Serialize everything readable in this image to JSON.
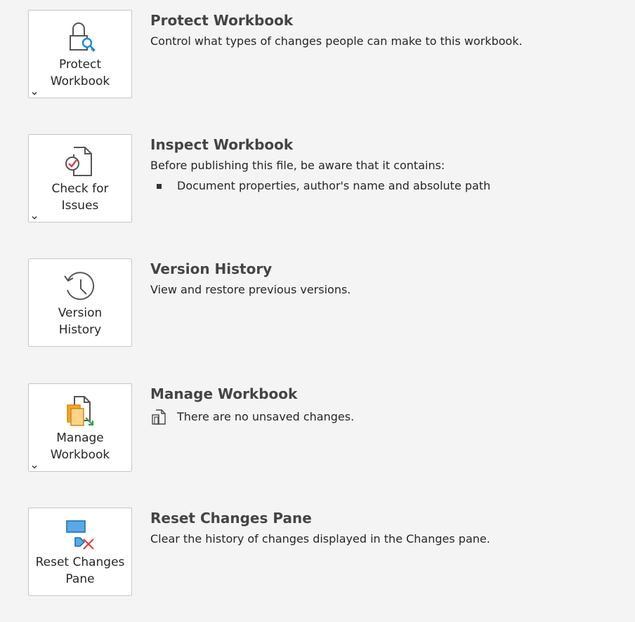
{
  "sections": [
    {
      "tile_label_1": "Protect",
      "tile_label_2": "Workbook",
      "title": "Protect Workbook",
      "description": "Control what types of changes people can make to this workbook.",
      "icon": "lock-key-icon",
      "has_dropdown": true
    },
    {
      "tile_label_1": "Check for",
      "tile_label_2": "Issues",
      "title": "Inspect Workbook",
      "description": "Before publishing this file, be aware that it contains:",
      "bullet": "Document properties, author's name and absolute path",
      "icon": "document-check-icon",
      "has_dropdown": true
    },
    {
      "tile_label_1": "Version",
      "tile_label_2": "History",
      "title": "Version History",
      "description": "View and restore previous versions.",
      "icon": "history-clock-icon",
      "has_dropdown": false
    },
    {
      "tile_label_1": "Manage",
      "tile_label_2": "Workbook",
      "title": "Manage Workbook",
      "status": "There are no unsaved changes.",
      "icon": "manage-documents-icon",
      "has_dropdown": true
    },
    {
      "tile_label_1": "Reset Changes",
      "tile_label_2": "Pane",
      "title": "Reset Changes Pane",
      "description": "Clear the history of changes displayed in the Changes pane.",
      "icon": "reset-pane-icon",
      "has_dropdown": false
    }
  ],
  "colors": {
    "background": "#f4f4f4",
    "tile_border": "#c6c6c6",
    "accent_blue": "#1e88d6",
    "accent_red": "#e03c3c",
    "accent_orange": "#f5a623",
    "accent_green": "#2e9e4a"
  }
}
